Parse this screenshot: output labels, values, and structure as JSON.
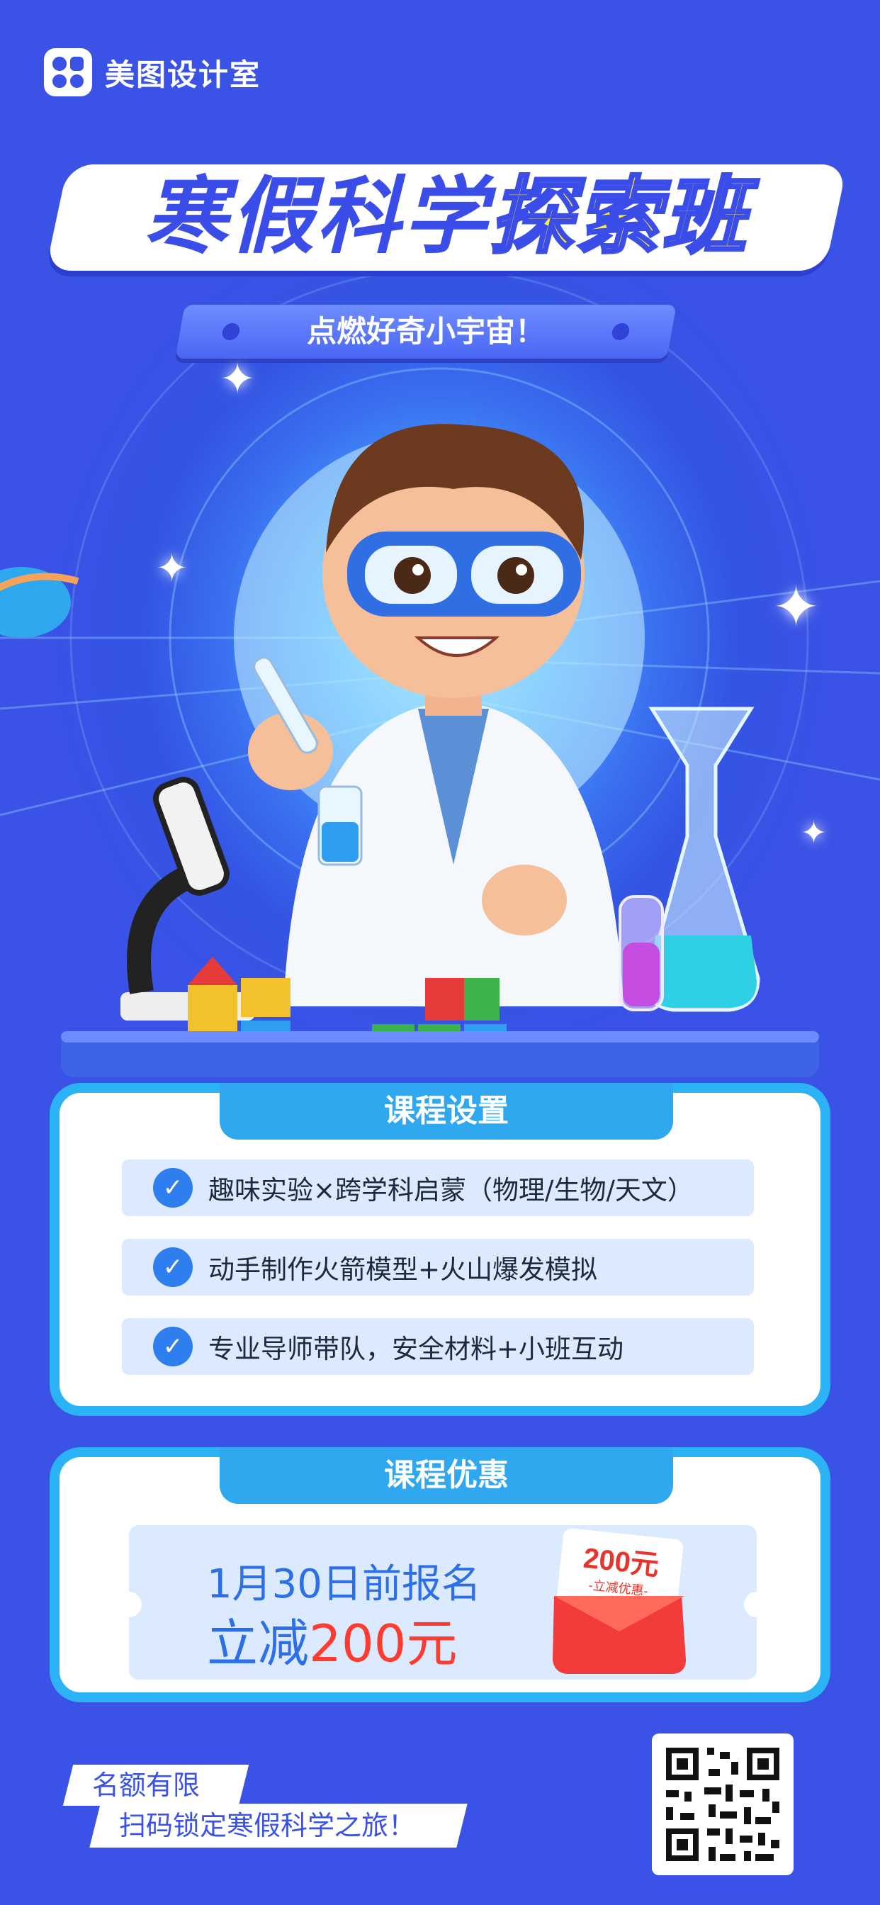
{
  "brand": {
    "name": "美图设计室"
  },
  "header": {
    "title_part1": "寒假科学",
    "title_part2": "探索班",
    "subtitle": "点燃好奇小宇宙！"
  },
  "course_settings": {
    "heading": "课程设置",
    "items": [
      {
        "label": "趣味实验×跨学科启蒙（物理/生物/天文）"
      },
      {
        "label": "动手制作火箭模型+火山爆发模拟"
      },
      {
        "label": "专业导师带队，安全材料+小班互动"
      }
    ]
  },
  "course_offer": {
    "heading": "课程优惠",
    "line1": "1月30日前报名",
    "line2_prefix": "立减",
    "line2_amount": "200元",
    "coupon_amount": "200元",
    "coupon_label": "-立减优惠-"
  },
  "footer": {
    "line1": "名额有限",
    "line2": "扫码锁定寒假科学之旅！"
  },
  "colors": {
    "background": "#3a52e6",
    "accent_yellow": "#ffea3a",
    "card_border": "#2cb3f5",
    "price_red": "#ff3b2f",
    "offer_blue": "#2c6fe6"
  },
  "icons": [
    "check-icon",
    "sparkle-icon",
    "microscope-icon",
    "flask-icon",
    "test-tube-icon",
    "building-blocks-icon",
    "qr-code-icon",
    "red-envelope-icon"
  ]
}
